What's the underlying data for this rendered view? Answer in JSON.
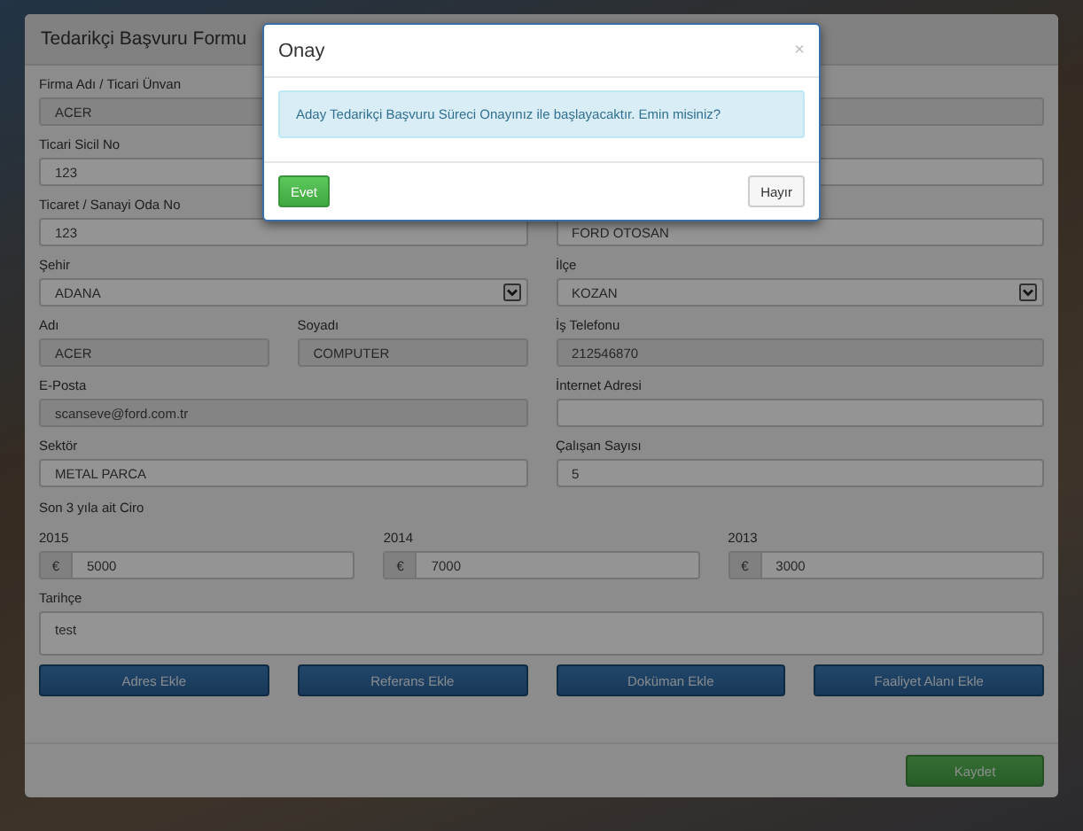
{
  "form": {
    "title": "Tedarikçi Başvuru Formu",
    "rows": [
      {
        "kind": "full",
        "fields": [
          {
            "label": "Firma Adı / Ticari Ünvan",
            "value": "ACER",
            "kind": "text",
            "disabled": true
          }
        ]
      },
      {
        "kind": "full",
        "fields": [
          {
            "label": "Ticari Sicil No",
            "value": "123",
            "kind": "text",
            "disabled": false
          }
        ]
      },
      {
        "kind": "halves",
        "fields": [
          {
            "label": "Ticaret / Sanayi Oda No",
            "value": "123",
            "kind": "text",
            "disabled": false
          },
          {
            "value": "FORD OTOSAN",
            "kind": "text",
            "disabled": false
          }
        ]
      },
      {
        "kind": "halves",
        "fields": [
          {
            "label": "Şehir",
            "value": "ADANA",
            "kind": "select",
            "disabled": false
          },
          {
            "label": "İlçe",
            "value": "KOZAN",
            "kind": "select",
            "disabled": false
          }
        ]
      },
      {
        "kind": "quarters",
        "fields": [
          {
            "label": "Adı",
            "value": "ACER",
            "kind": "text",
            "disabled": true
          },
          {
            "label": "Soyadı",
            "value": "COMPUTER",
            "kind": "text",
            "disabled": true
          },
          {
            "label": "İş Telefonu",
            "value": "212546870",
            "kind": "text",
            "disabled": true
          }
        ]
      },
      {
        "kind": "halves",
        "fields": [
          {
            "label": "E-Posta",
            "value": "scanseve@ford.com.tr",
            "kind": "text",
            "disabled": true
          },
          {
            "label": "İnternet Adresi",
            "kind": "text",
            "disabled": false
          }
        ]
      },
      {
        "kind": "halves",
        "fields": [
          {
            "label": "Sektör",
            "value": "METAL PARCA",
            "kind": "text",
            "disabled": false
          },
          {
            "label": "Çalışan Sayısı",
            "value": "5",
            "kind": "text",
            "disabled": false
          }
        ]
      },
      {
        "kind": "heading",
        "text": "Son 3 yıla ait Ciro"
      },
      {
        "kind": "thirds",
        "fields": [
          {
            "label": "2015",
            "prefix": "€",
            "value": "5000",
            "kind": "currency",
            "disabled": false
          },
          {
            "label": "2014",
            "prefix": "€",
            "value": "7000",
            "kind": "currency",
            "disabled": false
          },
          {
            "label": "2013",
            "prefix": "€",
            "value": "3000",
            "kind": "currency",
            "disabled": false
          }
        ]
      },
      {
        "kind": "full",
        "fields": [
          {
            "label": "Tarihçe",
            "value": "test",
            "kind": "textarea",
            "disabled": false
          }
        ]
      }
    ],
    "add_buttons": [
      "Adres Ekle",
      "Referans Ekle",
      "Doküman Ekle",
      "Faaliyet Alanı Ekle"
    ],
    "save_button": "Kaydet"
  },
  "modal": {
    "title": "Onay",
    "close": "×",
    "message": "Aday Tedarikçi Başvuru Süreci Onayınız ile başlayacaktır. Emin misiniz?",
    "buttons": [
      {
        "label": "Evet",
        "kind": "primary"
      },
      {
        "label": "Hayır",
        "kind": "default"
      }
    ]
  }
}
